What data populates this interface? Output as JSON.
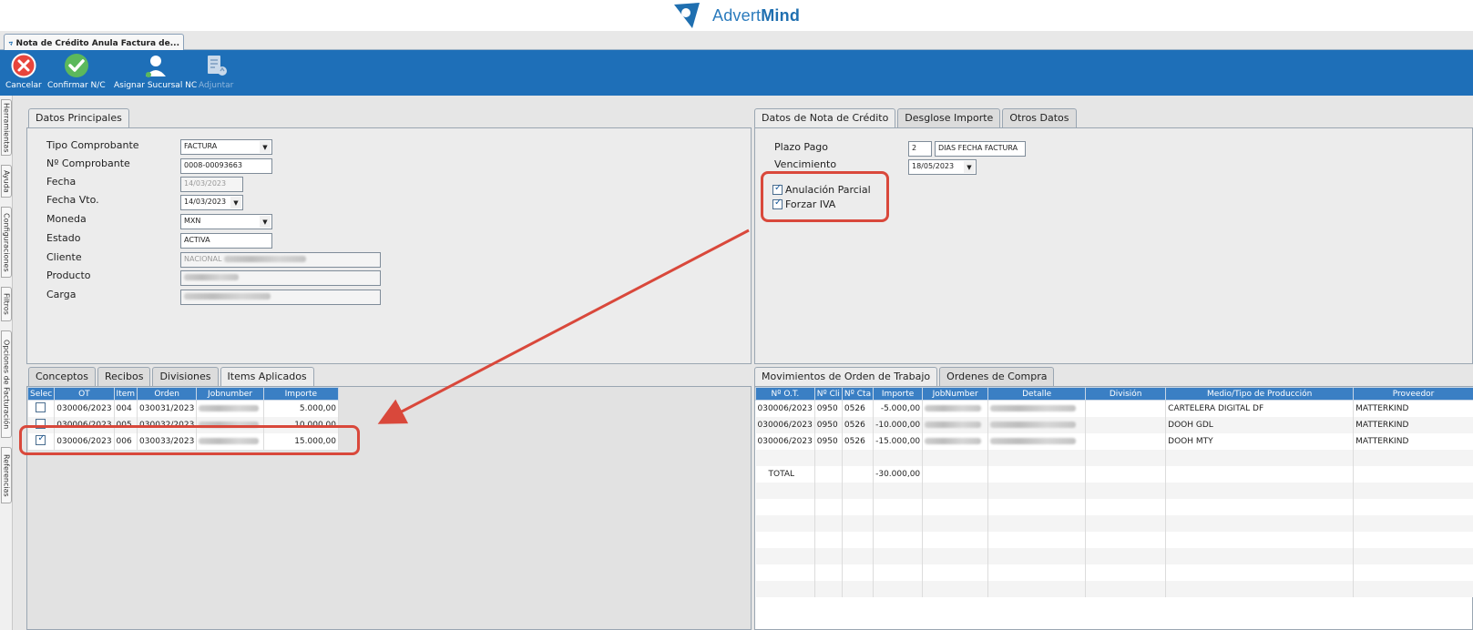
{
  "brand": {
    "name_light": "Advert",
    "name_bold": "Mind"
  },
  "window_tab": {
    "label": "Nota de Crédito Anula Factura de..."
  },
  "toolbar": {
    "cancel": "Cancelar",
    "confirm": "Confirmar N/C",
    "assign": "Asignar Sucursal NC",
    "attach": "Adjuntar"
  },
  "side_tabs": [
    "Herramientas",
    "Ayuda",
    "Configuraciones",
    "Filtros",
    "Opciones de Facturación",
    "Referencias"
  ],
  "main": {
    "tab": "Datos Principales",
    "fields": {
      "tipo_comprobante": {
        "label": "Tipo Comprobante",
        "value": "FACTURA"
      },
      "nro_comprobante": {
        "label": "Nº Comprobante",
        "value": "0008-00093663"
      },
      "fecha": {
        "label": "Fecha",
        "value": "14/03/2023"
      },
      "fecha_vto": {
        "label": "Fecha Vto.",
        "value": "14/03/2023"
      },
      "moneda": {
        "label": "Moneda",
        "value": "MXN"
      },
      "estado": {
        "label": "Estado",
        "value": "ACTIVA"
      },
      "cliente": {
        "label": "Cliente",
        "value": "NACIONAL"
      },
      "producto": {
        "label": "Producto"
      },
      "carga": {
        "label": "Carga"
      }
    }
  },
  "nota": {
    "tabs": [
      "Datos de Nota de Crédito",
      "Desglose Importe",
      "Otros Datos"
    ],
    "plazo_pago": {
      "label": "Plazo Pago",
      "value": "2",
      "unit": "DIAS FECHA FACTURA"
    },
    "vencimiento": {
      "label": "Vencimiento",
      "value": "18/05/2023"
    },
    "anulacion_parcial": "Anulación Parcial",
    "forzar_iva": "Forzar IVA"
  },
  "items": {
    "tabs": [
      "Conceptos",
      "Recibos",
      "Divisiones",
      "Items Aplicados"
    ],
    "headers": [
      "Selec",
      "OT",
      "Item",
      "Orden",
      "Jobnumber",
      "Importe"
    ],
    "rows": [
      {
        "checked": false,
        "ot": "030006/2023",
        "item": "004",
        "orden": "030031/2023",
        "importe": "5.000,00"
      },
      {
        "checked": false,
        "ot": "030006/2023",
        "item": "005",
        "orden": "030032/2023",
        "importe": "10.000,00"
      },
      {
        "checked": true,
        "ot": "030006/2023",
        "item": "006",
        "orden": "030033/2023",
        "importe": "15.000,00"
      }
    ]
  },
  "movimientos": {
    "tabs": [
      "Movimientos de Orden de Trabajo",
      "Ordenes de Compra"
    ],
    "headers": [
      "Nº O.T.",
      "Nº Cli",
      "Nº Cta",
      "Importe",
      "JobNumber",
      "Detalle",
      "División",
      "Medio/Tipo de Producción",
      "Proveedor"
    ],
    "rows": [
      {
        "ot": "030006/2023",
        "cli": "0950",
        "cta": "0526",
        "importe": "-5.000,00",
        "medio": "CARTELERA DIGITAL DF",
        "proveedor": "MATTERKIND"
      },
      {
        "ot": "030006/2023",
        "cli": "0950",
        "cta": "0526",
        "importe": "-10.000,00",
        "medio": "DOOH GDL",
        "proveedor": "MATTERKIND"
      },
      {
        "ot": "030006/2023",
        "cli": "0950",
        "cta": "0526",
        "importe": "-15.000,00",
        "medio": "DOOH MTY",
        "proveedor": "MATTERKIND"
      }
    ],
    "total_label": "TOTAL",
    "total_value": "-30.000,00"
  },
  "colors": {
    "toolbar": "#1e6fb8",
    "grid_header": "#3a7fc4",
    "highlight": "#d9483b"
  }
}
